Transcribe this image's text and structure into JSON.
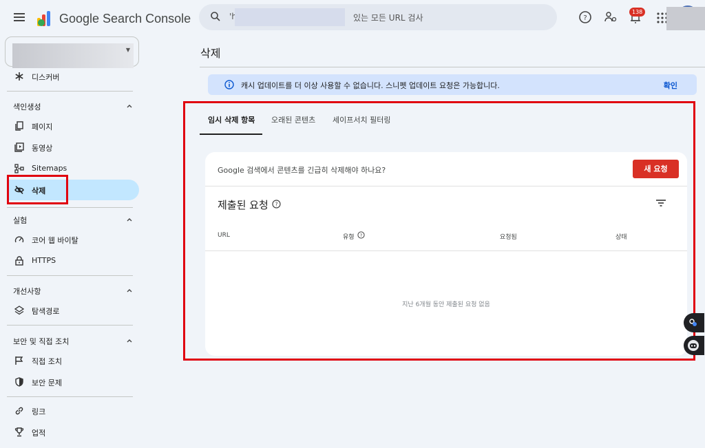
{
  "header": {
    "app_name": "Google Search Console",
    "search_prefix": "'h",
    "search_placeholder": "있는 모든 URL 검사",
    "notification_count": "138"
  },
  "sidebar": {
    "discover_label": "디스커버",
    "sections": [
      {
        "title": "색인생성",
        "items": [
          "페이지",
          "동영상",
          "Sitemaps",
          "삭제"
        ]
      },
      {
        "title": "실험",
        "items": [
          "코어 웹 바이탈",
          "HTTPS"
        ]
      },
      {
        "title": "개선사항",
        "items": [
          "탐색경로"
        ]
      },
      {
        "title": "보안 및 직접 조치",
        "items": [
          "직접 조치",
          "보안 문제"
        ]
      }
    ],
    "links_label": "링크",
    "achievements_label": "업적"
  },
  "main": {
    "title": "삭제",
    "banner_text": "캐시 업데이트를 더 이상 사용할 수 없습니다. 스니펫 업데이트 요청은 가능합니다.",
    "banner_confirm": "확인",
    "tabs": [
      "임시 삭제 항목",
      "오래된 콘텐츠",
      "세이프서치 필터링"
    ],
    "card": {
      "question": "Google 검색에서 콘텐츠를 긴급히 삭제해야 하나요?",
      "new_request": "새 요청",
      "submitted_title": "제출된 요청",
      "columns": [
        "URL",
        "유형",
        "요청됨",
        "상태"
      ],
      "empty_message": "지난 6개월 동안 제출된 요청 없음"
    }
  },
  "colors": {
    "accent_blue": "#0b57d0",
    "active_nav": "#c2e7ff",
    "danger_red": "#d93025",
    "highlight_box": "#e0000f"
  }
}
